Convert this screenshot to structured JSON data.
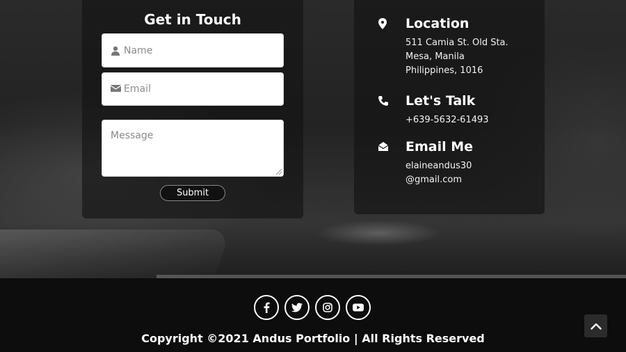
{
  "contact_form": {
    "title": "Get in Touch",
    "name_placeholder": "Name",
    "email_placeholder": "Email",
    "message_placeholder": "Message",
    "submit_label": "Submit",
    "name_icon": "user-icon",
    "email_icon": "envelope-icon"
  },
  "contact_info": {
    "location": {
      "heading": "Location",
      "lines": [
        "511 Camia St. Old Sta.",
        "Mesa, Manila",
        "Philippines, 1016"
      ],
      "icon": "map-pin-icon"
    },
    "talk": {
      "heading": "Let's Talk",
      "lines": [
        "+639-5632-61493"
      ],
      "icon": "phone-icon"
    },
    "email": {
      "heading": "Email Me",
      "lines": [
        "elaineandus30",
        "@gmail.com"
      ],
      "icon": "envelope-open-icon"
    }
  },
  "footer": {
    "socials": [
      {
        "icon": "facebook-icon"
      },
      {
        "icon": "twitter-icon"
      },
      {
        "icon": "instagram-icon"
      },
      {
        "icon": "youtube-icon"
      }
    ],
    "copyright": "Copyright ©2021 Andus Portfolio | All Rights Reserved",
    "back_to_top_icon": "chevron-up-icon"
  },
  "colors": {
    "background": "#111111",
    "card": "#121212",
    "text": "#ffffff",
    "input_bg": "#ffffff",
    "placeholder": "#8a8a8a"
  }
}
